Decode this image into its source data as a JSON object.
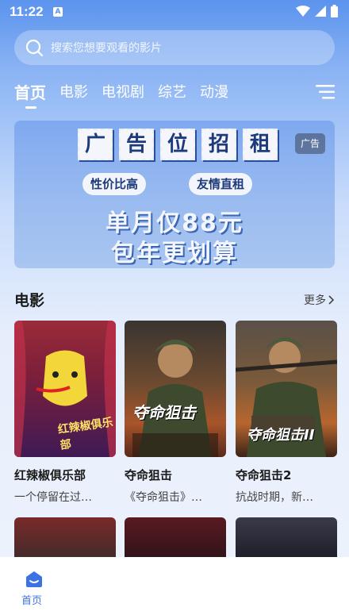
{
  "status_bar": {
    "time": "11:22",
    "notification_letter": "A"
  },
  "search": {
    "placeholder": "搜索您想要观看的影片"
  },
  "tabs": [
    {
      "label": "首页",
      "active": true
    },
    {
      "label": "电影",
      "active": false
    },
    {
      "label": "电视剧",
      "active": false
    },
    {
      "label": "综艺",
      "active": false
    },
    {
      "label": "动漫",
      "active": false
    }
  ],
  "banner": {
    "title_chars": [
      "广",
      "告",
      "位",
      "招",
      "租"
    ],
    "tag_left": "性价比高",
    "tag_right": "友情直租",
    "line1": "单月仅88元",
    "line2": "包年更划算",
    "ad_badge": "广告"
  },
  "section": {
    "title": "电影",
    "more": "更多"
  },
  "movies": [
    {
      "title": "红辣椒俱乐部",
      "desc": "一个停留在过…",
      "poster_text": "红辣椒俱乐部"
    },
    {
      "title": "夺命狙击",
      "desc": "《夺命狙击》…",
      "poster_text": "夺命狙击"
    },
    {
      "title": "夺命狙击2",
      "desc": "抗战时期，新…",
      "poster_text": "夺命狙击II"
    }
  ],
  "bottom_nav": {
    "home": "首页"
  },
  "colors": {
    "accent": "#3b73e6",
    "header_blue": "#5b93ee"
  }
}
